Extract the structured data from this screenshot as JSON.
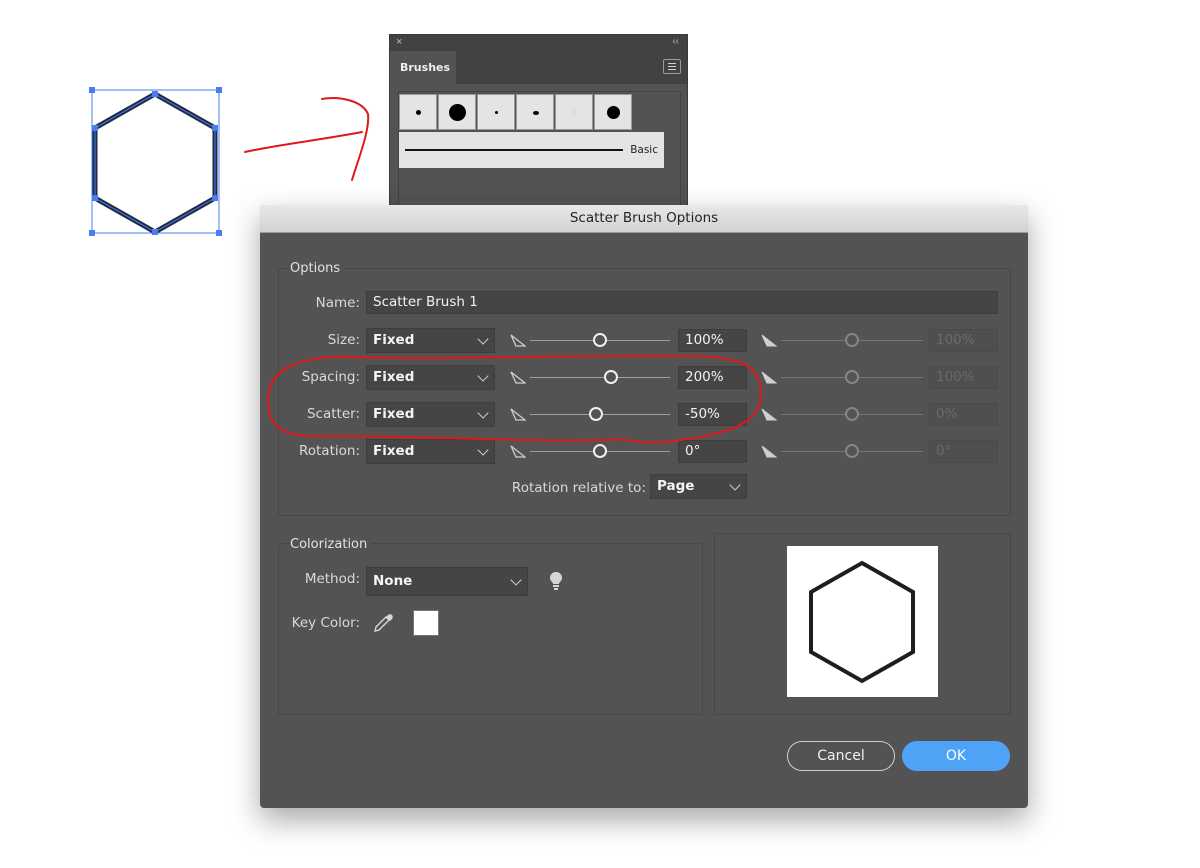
{
  "brushes_panel": {
    "close_glyph": "×",
    "collapse_glyph": "‹‹",
    "tab_label": "Brushes",
    "menu_icon": "hamburger-menu-icon",
    "basic_label": "Basic"
  },
  "dialog": {
    "title": "Scatter Brush Options",
    "options_group": {
      "title": "Options",
      "name_label": "Name:",
      "name_value": "Scatter Brush 1",
      "rows": [
        {
          "label": "Size:",
          "mode": "Fixed",
          "value": "100%",
          "value2": "100%",
          "slider": 0.5,
          "slider2": 0.5
        },
        {
          "label": "Spacing:",
          "mode": "Fixed",
          "value": "200%",
          "value2": "100%",
          "slider": 0.58,
          "slider2": 0.5
        },
        {
          "label": "Scatter:",
          "mode": "Fixed",
          "value": "-50%",
          "value2": "0%",
          "slider": 0.47,
          "slider2": 0.5
        },
        {
          "label": "Rotation:",
          "mode": "Fixed",
          "value": "0°",
          "value2": "0°",
          "slider": 0.5,
          "slider2": 0.5
        }
      ],
      "rotation_relative_label": "Rotation relative to:",
      "rotation_relative_value": "Page"
    },
    "colorization_group": {
      "title": "Colorization",
      "method_label": "Method:",
      "method_value": "None",
      "tip_icon": "lightbulb-icon",
      "key_color_label": "Key Color:",
      "eyedropper_icon": "eyedropper-icon",
      "key_color": "#ffffff"
    },
    "buttons": {
      "cancel": "Cancel",
      "ok": "OK"
    }
  },
  "colors": {
    "selection_blue": "#4a7ef0",
    "annotation_red": "#e01818",
    "ok_blue": "#4ea3f7"
  }
}
